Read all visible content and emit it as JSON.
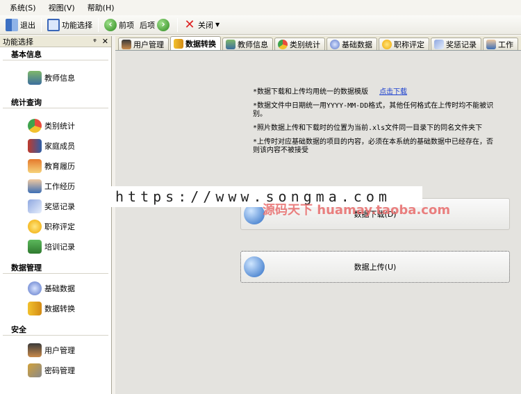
{
  "menu": [
    "系统(S)",
    "视图(V)",
    "帮助(H)"
  ],
  "toolbar": {
    "exit": "退出",
    "func_select": "功能选择",
    "prev": "前项",
    "next": "后项",
    "close": "关闭"
  },
  "panel": {
    "title": "功能选择",
    "pin": "ᵠ",
    "close": "✕",
    "groups": [
      {
        "title": "基本信息",
        "items": [
          "教师信息"
        ]
      },
      {
        "title": "统计查询",
        "items": [
          "类别统计",
          "家庭成员",
          "教育履历",
          "工作经历",
          "奖惩记录",
          "职称评定",
          "培训记录"
        ]
      },
      {
        "title": "数据管理",
        "items": [
          "基础数据",
          "数据转换"
        ]
      },
      {
        "title": "安全",
        "items": [
          "用户管理",
          "密码管理"
        ]
      }
    ]
  },
  "tabs": [
    "用户管理",
    "数据转换",
    "教师信息",
    "类别统计",
    "基础数据",
    "职称评定",
    "奖惩记录",
    "工作"
  ],
  "active_tab": "数据转换",
  "content": {
    "note1": "*数据下载和上传均用统一的数据模版",
    "note1_link": "点击下载",
    "note2": "*数据文件中日期统一用YYYY-MM-DD格式，其他任何格式在上传时均不能被识别。",
    "note3": "*照片数据上传和下载时的位置为当前.xls文件同一目录下的同名文件夹下",
    "note4": "*上传时对应基础数据的项目的内容，必须在本系统的基础数据中已经存在，否则该内容不被接受",
    "download_btn": "数据下载(D)",
    "upload_btn": "数据上传(U)"
  },
  "watermark": {
    "url": "https://www.songma.com",
    "red": "源码天下 huamay.taoba.com"
  },
  "colors": {
    "accent_link": "#1a3fcf",
    "watermark_red": "#e86b6b"
  }
}
